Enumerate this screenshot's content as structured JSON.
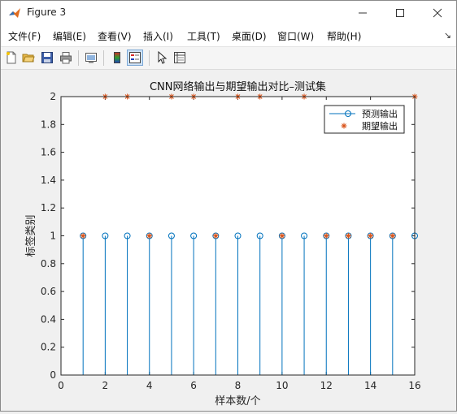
{
  "window": {
    "title": "Figure 3",
    "minimize": "—",
    "maximize": "☐",
    "close": "✕"
  },
  "menu": [
    {
      "label": "文件(F)"
    },
    {
      "label": "编辑(E)"
    },
    {
      "label": "查看(V)"
    },
    {
      "label": "插入(I)"
    },
    {
      "label": "工具(T)"
    },
    {
      "label": "桌面(D)"
    },
    {
      "label": "窗口(W)"
    },
    {
      "label": "帮助(H)"
    }
  ],
  "menu_overflow": "↘",
  "toolbar": [
    "new-figure-icon",
    "open-file-icon",
    "save-icon",
    "print-icon",
    "link-plot-icon",
    "colorbar-icon",
    "legend-icon",
    "pointer-icon",
    "property-inspector-icon"
  ],
  "colors": {
    "predicted": "#0072bd",
    "expected": "#d95319"
  },
  "chart_data": {
    "type": "scatter",
    "title": "CNN网络输出与期望输出对比–测试集",
    "xlabel": "样本数/个",
    "ylabel": "标签类别",
    "xlim": [
      0,
      16
    ],
    "ylim": [
      0,
      2
    ],
    "xticks": [
      "0",
      "2",
      "4",
      "6",
      "8",
      "10",
      "12",
      "14",
      "16"
    ],
    "yticks": [
      "0",
      "0.2",
      "0.4",
      "0.6",
      "0.8",
      "1",
      "1.2",
      "1.4",
      "1.6",
      "1.8",
      "2"
    ],
    "grid": false,
    "legend_position": "top-right",
    "x": [
      1,
      2,
      3,
      4,
      5,
      6,
      7,
      8,
      9,
      10,
      11,
      12,
      13,
      14,
      15,
      16
    ],
    "series": [
      {
        "name": "预测输出",
        "style": "stem",
        "marker": "o",
        "values": [
          1,
          1,
          1,
          1,
          1,
          1,
          1,
          1,
          1,
          1,
          1,
          1,
          1,
          1,
          1,
          1
        ]
      },
      {
        "name": "期望输出",
        "style": "marker",
        "marker": "*",
        "values": [
          1,
          2,
          2,
          1,
          2,
          2,
          1,
          2,
          2,
          1,
          2,
          1,
          1,
          1,
          1,
          2
        ]
      }
    ]
  }
}
